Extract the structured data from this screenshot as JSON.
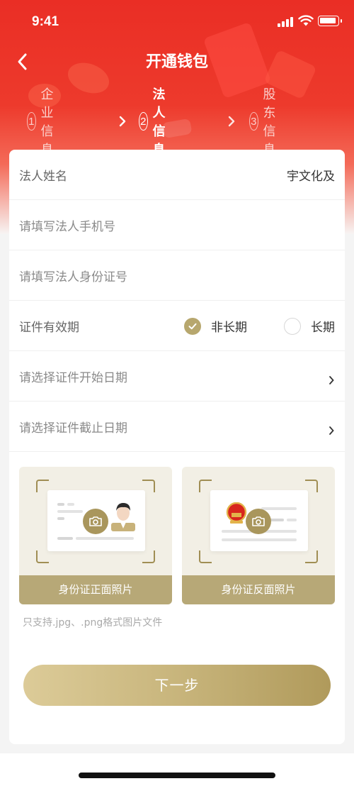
{
  "status_bar": {
    "time": "9:41"
  },
  "header": {
    "title": "开通钱包"
  },
  "steps": [
    {
      "number": "1",
      "label": "企业信息",
      "active": false
    },
    {
      "number": "2",
      "label": "法人信息",
      "active": true
    },
    {
      "number": "3",
      "label": "股东信息",
      "active": false
    }
  ],
  "form": {
    "name_label": "法人姓名",
    "name_value": "宇文化及",
    "phone_placeholder": "请填写法人手机号",
    "id_placeholder": "请填写法人身份证号",
    "validity_label": "证件有效期",
    "validity_options": [
      {
        "label": "非长期",
        "selected": true
      },
      {
        "label": "长期",
        "selected": false
      }
    ],
    "start_date_placeholder": "请选择证件开始日期",
    "end_date_placeholder": "请选择证件截止日期"
  },
  "uploads": {
    "front_label": "身份证正面照片",
    "back_label": "身份证反面照片",
    "hint": "只支持.jpg、.png格式图片文件"
  },
  "actions": {
    "next_label": "下一步"
  },
  "colors": {
    "brand_red": "#ea2e25",
    "gold": "#b7a76e"
  }
}
